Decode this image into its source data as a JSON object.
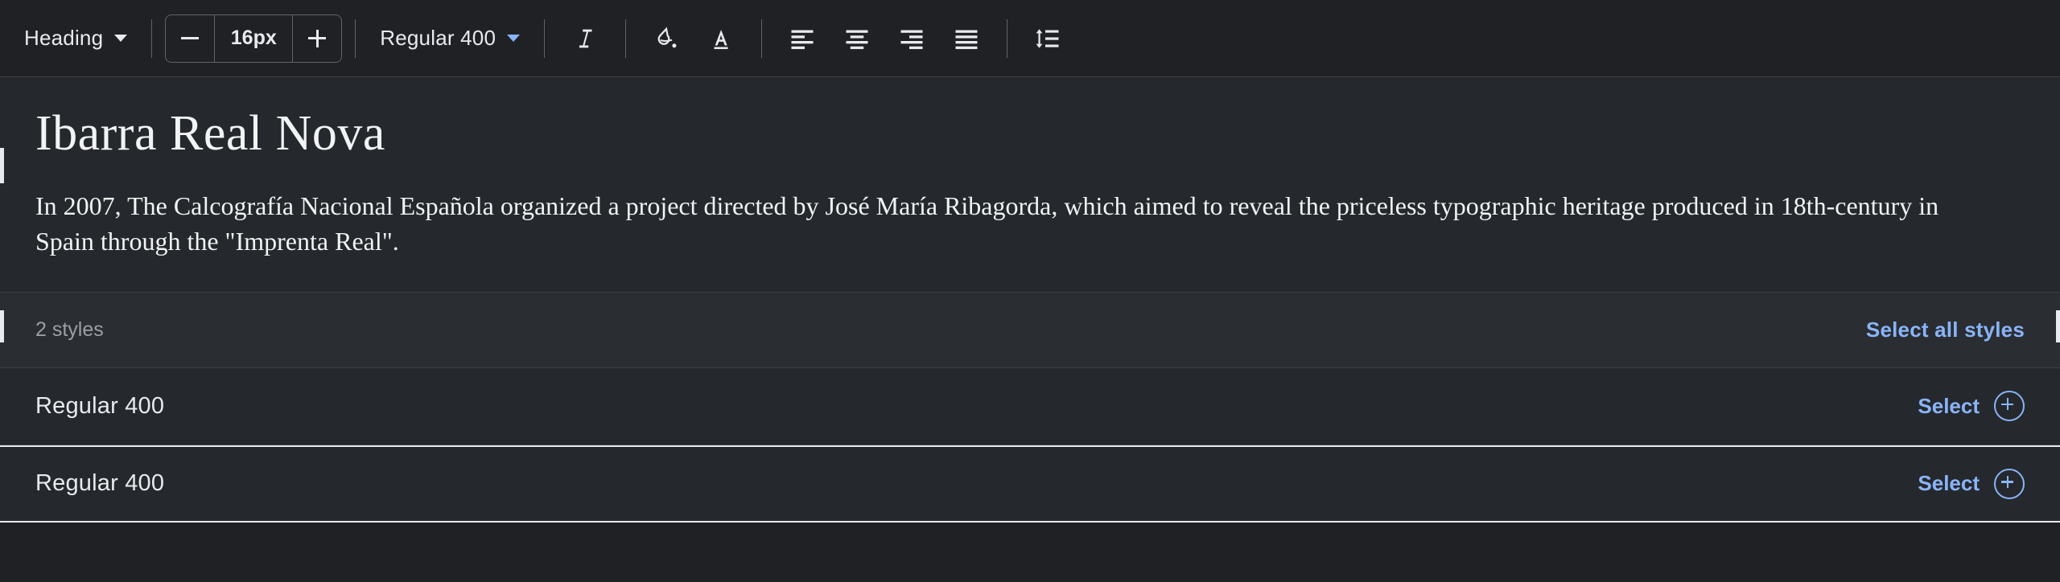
{
  "toolbar": {
    "heading_dropdown": {
      "label": "Heading",
      "icon": "chevron-down-icon"
    },
    "size_stepper": {
      "decrease_label": "−",
      "value": "16px",
      "increase_label": "+"
    },
    "weight_dropdown": {
      "label": "Regular 400",
      "icon": "chevron-down-icon"
    },
    "icons": [
      {
        "name": "italic-icon",
        "title": "Italic"
      },
      {
        "name": "fill-color-icon",
        "title": "Background color"
      },
      {
        "name": "text-color-icon",
        "title": "Text color"
      },
      {
        "name": "align-left-icon",
        "title": "Align left"
      },
      {
        "name": "align-center-icon",
        "title": "Align center"
      },
      {
        "name": "align-right-icon",
        "title": "Align right"
      },
      {
        "name": "align-justify-icon",
        "title": "Justify"
      },
      {
        "name": "line-height-icon",
        "title": "Line height"
      }
    ]
  },
  "preview": {
    "title": "Ibarra Real Nova",
    "body": "In 2007, The Calcografía Nacional Española organized a project directed by José María Ribagorda, which aimed to reveal the priceless typographic heritage produced in 18th-century in Spain through the \"Imprenta Real\"."
  },
  "styles_panel": {
    "count_label": "2 styles",
    "select_all_label": "Select all styles",
    "rows": [
      {
        "name": "Regular 400",
        "action_label": "Select",
        "action_icon": "plus-circle-icon",
        "highlighted": false
      },
      {
        "name": "Regular 400",
        "action_label": "Select",
        "action_icon": "plus-circle-icon",
        "highlighted": true
      }
    ]
  },
  "colors": {
    "background": "#202124",
    "panel": "#25282c",
    "accent_blue": "#8ab4f8",
    "text_primary": "#e8eaed",
    "text_secondary": "#9aa0a6",
    "border": "#3c4043"
  }
}
